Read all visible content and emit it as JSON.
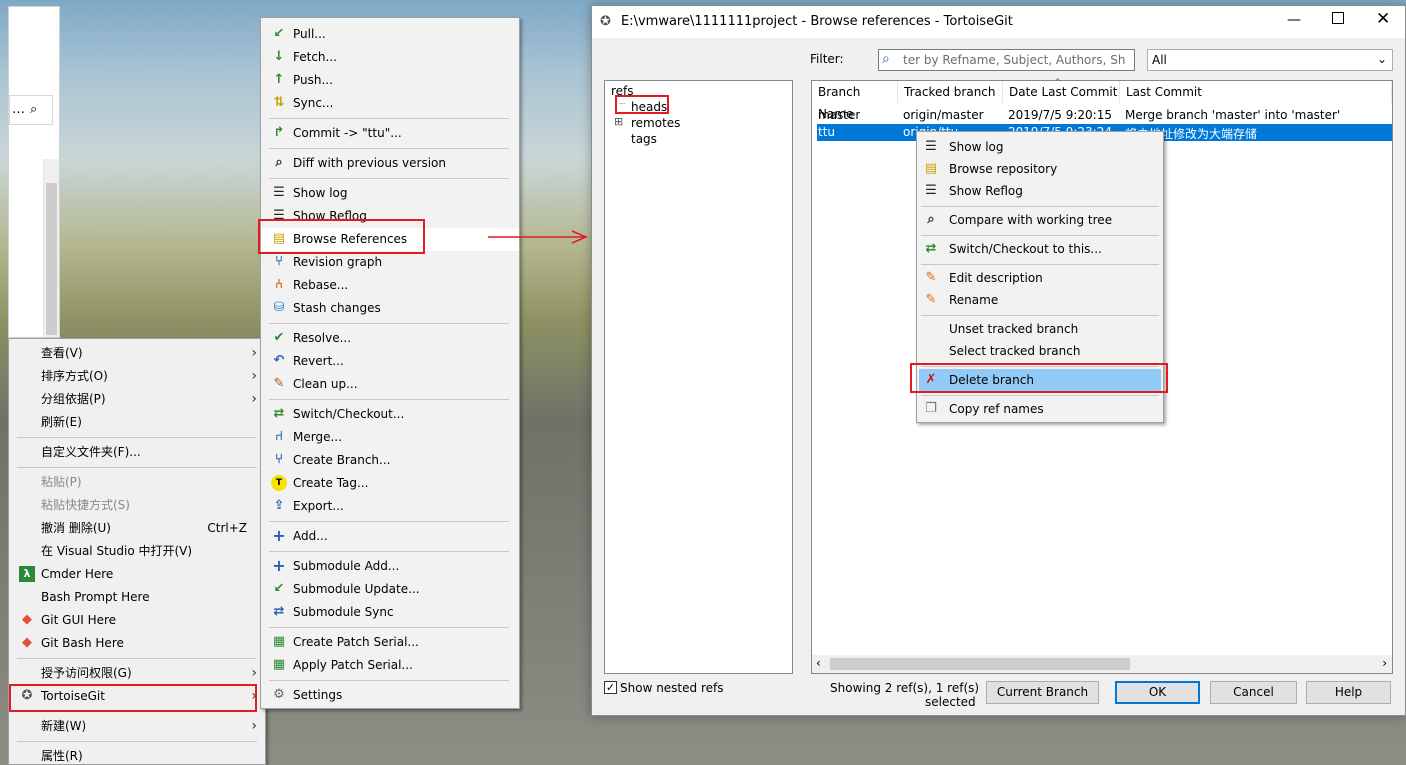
{
  "explorer_menu": {
    "items": [
      {
        "label": "查看(V)",
        "submenu": true
      },
      {
        "label": "排序方式(O)",
        "submenu": true
      },
      {
        "label": "分组依据(P)",
        "submenu": true
      },
      {
        "label": "刷新(E)"
      },
      {
        "label": "自定义文件夹(F)..."
      },
      {
        "label": "粘贴(P)",
        "disabled": true
      },
      {
        "label": "粘贴快捷方式(S)",
        "disabled": true
      },
      {
        "label": "撤消 删除(U)",
        "shortcut": "Ctrl+Z"
      },
      {
        "label": "在 Visual Studio 中打开(V)"
      },
      {
        "label": "Cmder Here",
        "icon": "cmder-icon"
      },
      {
        "label": "Bash Prompt Here"
      },
      {
        "label": "Git GUI Here",
        "icon": "git-icon"
      },
      {
        "label": "Git Bash Here",
        "icon": "git-icon"
      },
      {
        "label": "授予访问权限(G)",
        "submenu": true
      },
      {
        "label": "TortoiseGit",
        "icon": "tortoisegit-icon",
        "submenu": true
      },
      {
        "label": "新建(W)",
        "submenu": true
      },
      {
        "label": "属性(R)"
      }
    ]
  },
  "tgit_menu": {
    "items": [
      {
        "label": "Pull...",
        "icon": "pull-icon"
      },
      {
        "label": "Fetch...",
        "icon": "fetch-icon"
      },
      {
        "label": "Push...",
        "icon": "push-icon"
      },
      {
        "label": "Sync...",
        "icon": "sync-icon"
      },
      {
        "label": "Commit -> \"ttu\"...",
        "icon": "commit-icon"
      },
      {
        "label": "Diff with previous version",
        "icon": "diff-icon"
      },
      {
        "label": "Show log",
        "icon": "log-icon"
      },
      {
        "label": "Show Reflog",
        "icon": "reflog-icon"
      },
      {
        "label": "Browse References",
        "icon": "references-icon"
      },
      {
        "label": "Revision graph",
        "icon": "revision-graph-icon"
      },
      {
        "label": "Rebase...",
        "icon": "rebase-icon"
      },
      {
        "label": "Stash changes",
        "icon": "stash-icon"
      },
      {
        "label": "Resolve...",
        "icon": "resolve-icon"
      },
      {
        "label": "Revert...",
        "icon": "revert-icon"
      },
      {
        "label": "Clean up...",
        "icon": "cleanup-icon"
      },
      {
        "label": "Switch/Checkout...",
        "icon": "switch-icon"
      },
      {
        "label": "Merge...",
        "icon": "merge-icon"
      },
      {
        "label": "Create Branch...",
        "icon": "branch-icon"
      },
      {
        "label": "Create Tag...",
        "icon": "tag-icon"
      },
      {
        "label": "Export...",
        "icon": "export-icon"
      },
      {
        "label": "Add...",
        "icon": "add-icon"
      },
      {
        "label": "Submodule Add...",
        "icon": "submodule-add-icon"
      },
      {
        "label": "Submodule Update...",
        "icon": "submodule-update-icon"
      },
      {
        "label": "Submodule Sync",
        "icon": "submodule-sync-icon"
      },
      {
        "label": "Create Patch Serial...",
        "icon": "patch-icon"
      },
      {
        "label": "Apply Patch Serial...",
        "icon": "apply-patch-icon"
      },
      {
        "label": "Settings",
        "icon": "settings-icon"
      }
    ]
  },
  "window": {
    "title": "E:\\vmware\\1111111project - Browse references - TortoiseGit",
    "filter_label": "Filter:",
    "filter_placeholder": "ter by Refname, Subject, Authors, Sh",
    "filter_scope": "All",
    "tree": {
      "root": "refs",
      "heads": "heads",
      "remotes": "remotes",
      "tags": "tags",
      "expander": "⊞"
    },
    "columns": [
      "Branch Name",
      "Tracked branch",
      "Date Last Commit",
      "Last Commit"
    ],
    "rows": [
      {
        "branch": "master",
        "tracked": "origin/master",
        "date": "2019/7/5 9:20:15",
        "commit": "Merge branch 'master' into 'master'",
        "selected": false
      },
      {
        "branch": "ttu",
        "tracked": "origin/ttu",
        "date": "2019/7/5 9:23:24",
        "commit": "将未地址修改为大端存储",
        "selected": true
      }
    ],
    "show_nested_label": "Show nested refs",
    "show_nested_checked": true,
    "status_line1": "Showing 2 ref(s), 1 ref(s)",
    "status_line2": "selected",
    "buttons": {
      "current_branch": "Current Branch",
      "ok": "OK",
      "cancel": "Cancel",
      "help": "Help"
    }
  },
  "ref_menu": {
    "items": [
      {
        "label": "Show log",
        "icon": "log-icon"
      },
      {
        "label": "Browse repository",
        "icon": "repository-icon"
      },
      {
        "label": "Show Reflog",
        "icon": "reflog-icon"
      },
      {
        "label": "Compare with working tree",
        "icon": "compare-icon"
      },
      {
        "label": "Switch/Checkout to this...",
        "icon": "switch-icon"
      },
      {
        "label": "Edit description",
        "icon": "edit-icon"
      },
      {
        "label": "Rename",
        "icon": "rename-icon"
      },
      {
        "label": "Unset tracked branch"
      },
      {
        "label": "Select tracked branch"
      },
      {
        "label": "Delete branch",
        "icon": "delete-icon",
        "highlighted": true
      },
      {
        "label": "Copy ref names",
        "icon": "copy-icon"
      }
    ]
  },
  "colors": {
    "selection": "#0078d7",
    "menu_highlight": "#91c9f7",
    "annotation": "#e31c23"
  }
}
